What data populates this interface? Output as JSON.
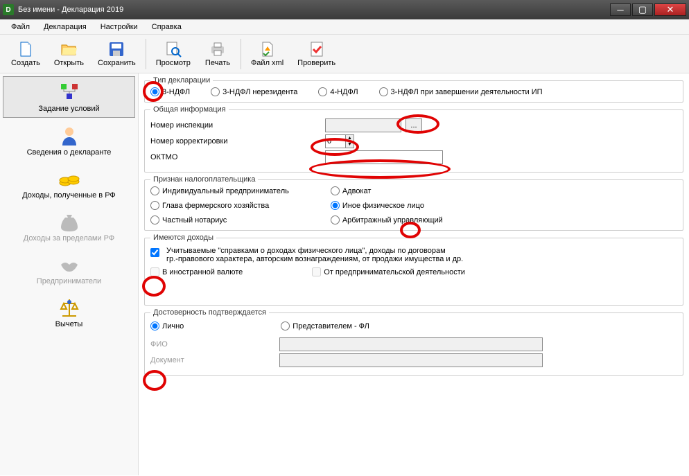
{
  "window": {
    "title": "Без имени - Декларация 2019",
    "app_icon_letter": "D"
  },
  "menu": [
    "Файл",
    "Декларация",
    "Настройки",
    "Справка"
  ],
  "toolbar": {
    "create": "Создать",
    "open": "Открыть",
    "save": "Сохранить",
    "preview": "Просмотр",
    "print": "Печать",
    "xml": "Файл xml",
    "check": "Проверить"
  },
  "nav": {
    "conditions": "Задание условий",
    "declarant": "Сведения о декларанте",
    "income_rf": "Доходы, полученные в РФ",
    "income_abroad": "Доходы за пределами РФ",
    "entrepreneur": "Предприниматели",
    "deductions": "Вычеты"
  },
  "decl_type": {
    "legend": "Тип декларации",
    "r1": "3-НДФЛ",
    "r2": "3-НДФЛ нерезидента",
    "r3": "4-НДФЛ",
    "r4": "3-НДФЛ при завершении деятельности ИП"
  },
  "general": {
    "legend": "Общая информация",
    "inspection_label": "Номер инспекции",
    "inspection_value": "",
    "browse_label": "...",
    "correction_label": "Номер корректировки",
    "correction_value": "0",
    "oktmo_label": "ОКТМО",
    "oktmo_value": ""
  },
  "taxpayer": {
    "legend": "Признак налогоплательщика",
    "r1": "Индивидуальный предприниматель",
    "r2": "Глава фермерского хозяйства",
    "r3": "Частный нотариус",
    "r4": "Адвокат",
    "r5": "Иное физическое лицо",
    "r6": "Арбитражный управляющий"
  },
  "income": {
    "legend": "Имеются доходы",
    "c1_line1": "Учитываемые \"справками о доходах физического лица\", доходы по договорам",
    "c1_line2": "гр.-правового характера, авторским вознаграждениям, от продажи имущества и др.",
    "c2": "В иностранной валюте",
    "c3": "От предпринимательской деятельности"
  },
  "reliability": {
    "legend": "Достоверность подтверждается",
    "r1": "Лично",
    "r2": "Представителем - ФЛ",
    "fio_label": "ФИО",
    "doc_label": "Документ",
    "fio_value": "",
    "doc_value": ""
  }
}
